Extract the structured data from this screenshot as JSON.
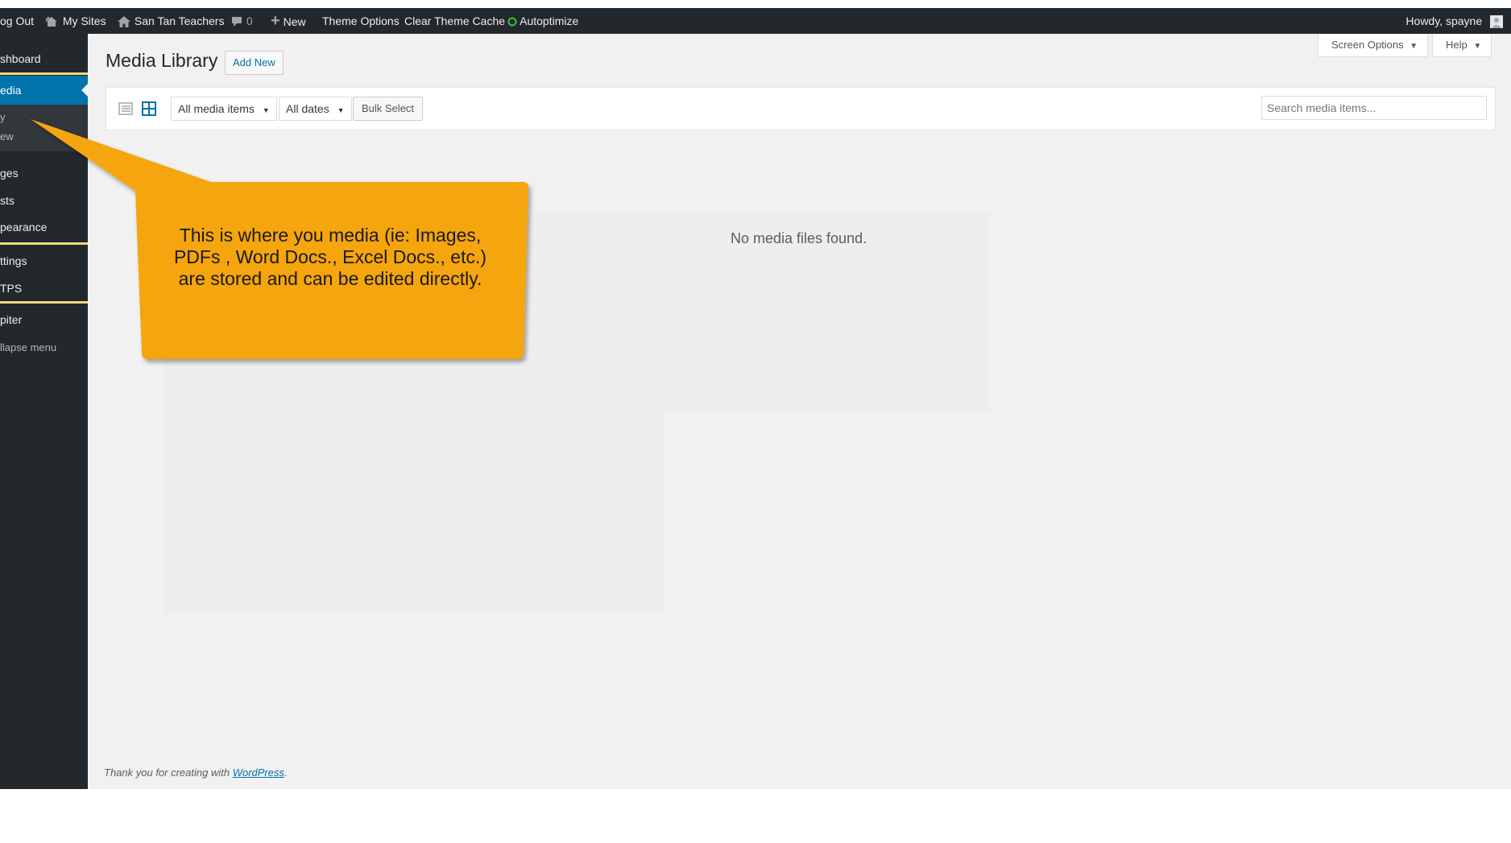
{
  "admin_bar": {
    "log_out": "og Out",
    "my_sites": "My Sites",
    "site_name": "San Tan Teachers",
    "comments_count": "0",
    "new_label": "New",
    "theme_options": "Theme Options",
    "clear_cache": "Clear Theme Cache",
    "autoptimize": "Autoptimize",
    "howdy": "Howdy, spayne"
  },
  "sidebar": {
    "items": [
      {
        "label": "shboard"
      },
      {
        "label": "edia"
      },
      {
        "label": "ges"
      },
      {
        "label": "sts"
      },
      {
        "label": "pearance"
      },
      {
        "label": "ttings"
      },
      {
        "label": "TPS"
      },
      {
        "label": "piter"
      }
    ],
    "sub_items": [
      {
        "label": "y"
      },
      {
        "label": "ew"
      }
    ],
    "collapse": "llapse menu"
  },
  "header": {
    "title": "Media Library",
    "add_new": "Add New",
    "screen_options": "Screen Options",
    "help": "Help"
  },
  "toolbar": {
    "filter_type": "All media items",
    "filter_date": "All dates",
    "bulk_select": "Bulk Select",
    "search_placeholder": "Search media items..."
  },
  "content": {
    "empty_message": "No media files found."
  },
  "footer": {
    "text": "Thank you for creating with ",
    "link": "WordPress",
    "end": "."
  },
  "callout": {
    "text": "This is where you media (ie: Images, PDFs , Word Docs., Excel Docs., etc.) are stored and can be edited directly."
  },
  "colors": {
    "admin_bar": "#23282d",
    "accent": "#0073aa",
    "callout": "#f5a50a",
    "separator": "#f3d77c"
  }
}
